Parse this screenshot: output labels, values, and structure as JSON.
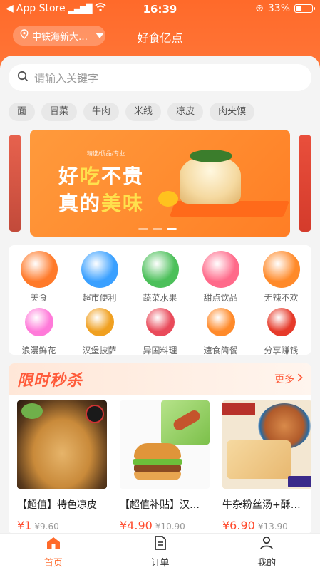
{
  "status_bar": {
    "carrier": "App Store",
    "time": "16:39",
    "battery": "33%",
    "battery_level": 0.33
  },
  "header": {
    "location": "中铁海新大…",
    "title": "好食亿点"
  },
  "search": {
    "placeholder": "请输入关键字"
  },
  "hot_tags": [
    "面",
    "冒菜",
    "牛肉",
    "米线",
    "凉皮",
    "肉夹馍"
  ],
  "banner": {
    "small_text": "精选/优品/专业",
    "line1_a": "好",
    "line1_hl": "吃",
    "line1_b": "不贵",
    "line2_a": "真的",
    "line2_hl": "美味",
    "page_count": 3,
    "active_page": 3
  },
  "categories": [
    {
      "label": "美食",
      "icon": "fork-spoon-icon",
      "color": "#ff7a2a"
    },
    {
      "label": "超市便利",
      "icon": "shop-icon",
      "color": "#3aa0ff"
    },
    {
      "label": "蔬菜水果",
      "icon": "fruit-icon",
      "color": "#4cc05a"
    },
    {
      "label": "甜点饮品",
      "icon": "drink-icon",
      "color": "#ff6a8a"
    },
    {
      "label": "无辣不欢",
      "icon": "chili-icon",
      "color": "#ff8a2a"
    },
    {
      "label": "浪漫鲜花",
      "icon": "flower-icon",
      "color": "#ff7ad9"
    },
    {
      "label": "汉堡披萨",
      "icon": "burger-icon",
      "color": "#f0a020"
    },
    {
      "label": "异国料理",
      "icon": "sushi-icon",
      "color": "#e94a5a"
    },
    {
      "label": "速食简餐",
      "icon": "bowl-icon",
      "color": "#ff8a2a"
    },
    {
      "label": "分享赚钱",
      "icon": "red-envelope-icon",
      "color": "#e63a2a"
    }
  ],
  "flash_sale": {
    "title": "限时秒杀",
    "more_label": "更多",
    "products": [
      {
        "name": "【超值】特色凉皮",
        "price": "¥1",
        "old_price": "¥9.60"
      },
      {
        "name": "【超值补贴】汉…",
        "price": "¥4.90",
        "old_price": "¥10.90"
      },
      {
        "name": "牛杂粉丝汤+酥…",
        "price": "¥6.90",
        "old_price": "¥13.90"
      }
    ]
  },
  "tabbar": {
    "items": [
      {
        "label": "首页"
      },
      {
        "label": "订单"
      },
      {
        "label": "我的"
      }
    ]
  }
}
